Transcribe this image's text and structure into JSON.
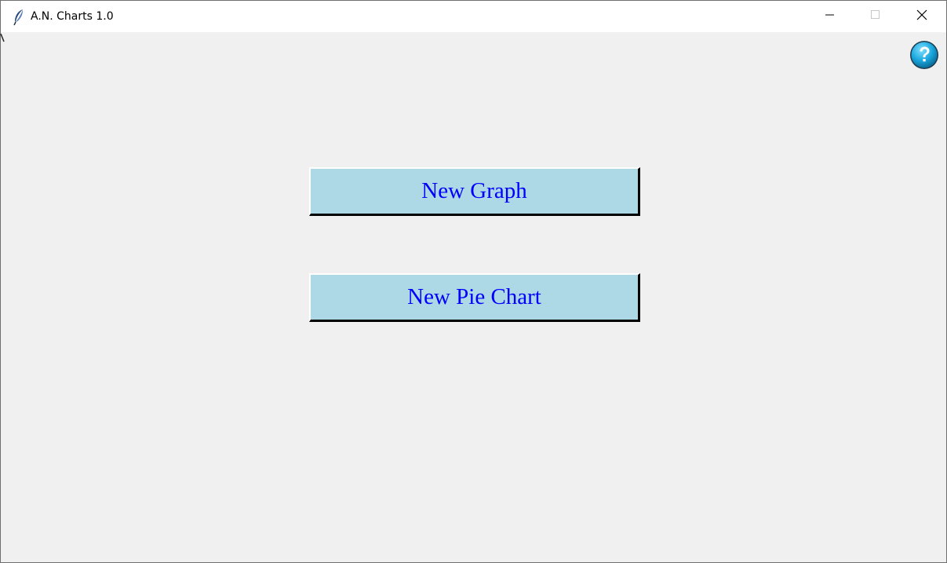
{
  "window": {
    "title": "A.N. Charts 1.0",
    "icons": {
      "app": "feather-icon",
      "minimize": "minimize-icon",
      "maximize": "maximize-icon",
      "close": "close-icon",
      "help": "help-icon"
    }
  },
  "main": {
    "new_graph_label": "New Graph",
    "new_pie_chart_label": "New Pie Chart"
  },
  "colors": {
    "button_background": "#add8e6",
    "button_text": "#0000ff",
    "client_background": "#f0f0f0",
    "help_icon": "#1aa7dd"
  }
}
